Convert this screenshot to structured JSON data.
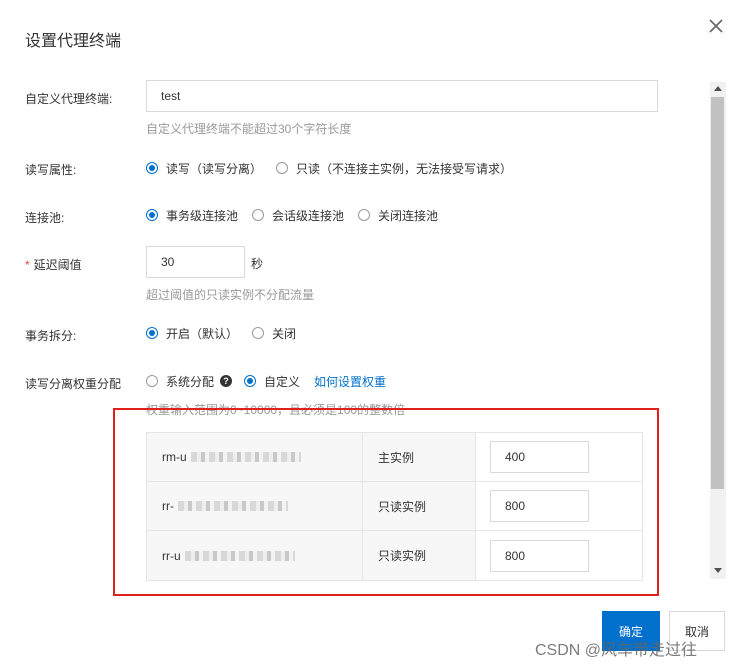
{
  "dialog": {
    "title": "设置代理终端"
  },
  "form": {
    "name": {
      "label": "自定义代理终端:",
      "value": "test",
      "hint": "自定义代理终端不能超过30个字符长度"
    },
    "rw": {
      "label": "读写属性:",
      "options": [
        "读写（读写分离）",
        "只读（不连接主实例，无法接受写请求）"
      ],
      "selected": 0
    },
    "pool": {
      "label": "连接池:",
      "options": [
        "事务级连接池",
        "会话级连接池",
        "关闭连接池"
      ],
      "selected": 0
    },
    "delay": {
      "required_mark": "*",
      "label": "延迟阈值",
      "value": "30",
      "unit": "秒",
      "hint": "超过阈值的只读实例不分配流量"
    },
    "split": {
      "label": "事务拆分:",
      "options": [
        "开启（默认）",
        "关闭"
      ],
      "selected": 0
    },
    "weight": {
      "label": "读写分离权重分配",
      "options": [
        "系统分配",
        "自定义"
      ],
      "selected": 1,
      "help_glyph": "?",
      "link": "如何设置权重",
      "hint": "权重输入范围为0~10000，且必须是100的整数倍"
    },
    "instances": [
      {
        "id": "rm-u",
        "type": "主实例",
        "weight": "400"
      },
      {
        "id": "rr-",
        "type": "只读实例",
        "weight": "800"
      },
      {
        "id": "rr-u",
        "type": "只读实例",
        "weight": "800"
      }
    ]
  },
  "footer": {
    "ok": "确定",
    "cancel": "取消"
  },
  "watermark": "CSDN @风车带走过往",
  "colors": {
    "primary": "#0070cc",
    "highlight_box": "#e0201a",
    "required": "#e9463a"
  }
}
